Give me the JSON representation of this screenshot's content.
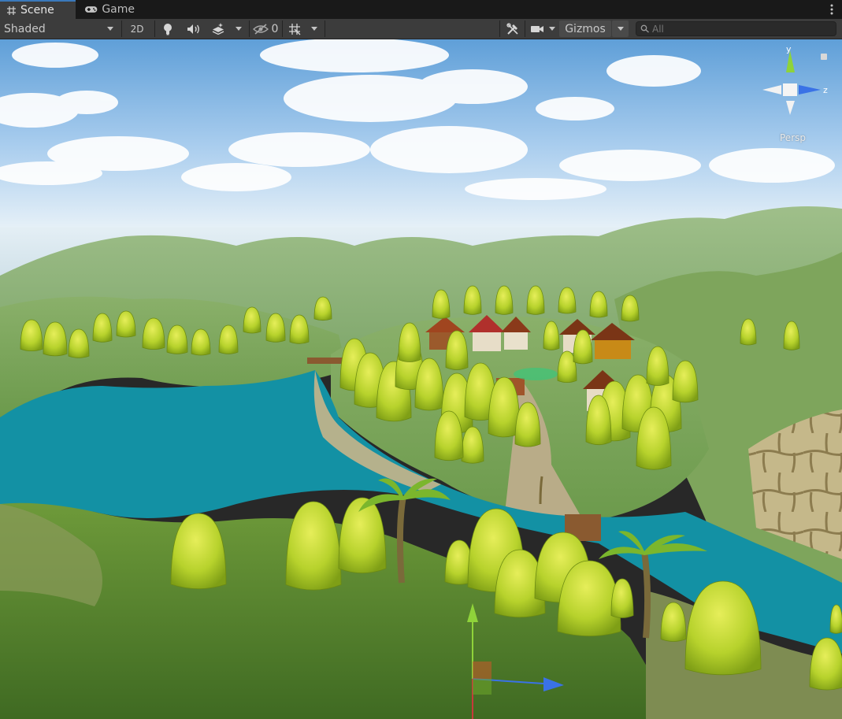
{
  "tabs": [
    {
      "label": "Scene",
      "icon": "hash-icon",
      "active": true
    },
    {
      "label": "Game",
      "icon": "gamepad-icon",
      "active": false
    }
  ],
  "toolbar": {
    "draw_mode": "Shaded",
    "mode_2d": "2D",
    "hidden_count": "0",
    "gizmos": "Gizmos",
    "search_placeholder": "All"
  },
  "scene_gizmo": {
    "y_label": "y",
    "z_label": "z",
    "projection": "Persp"
  },
  "colors": {
    "tab_accent": "#3a79bb",
    "axis_x": "#c73a3a",
    "axis_y": "#8fd33a",
    "axis_z": "#3a72e6"
  }
}
